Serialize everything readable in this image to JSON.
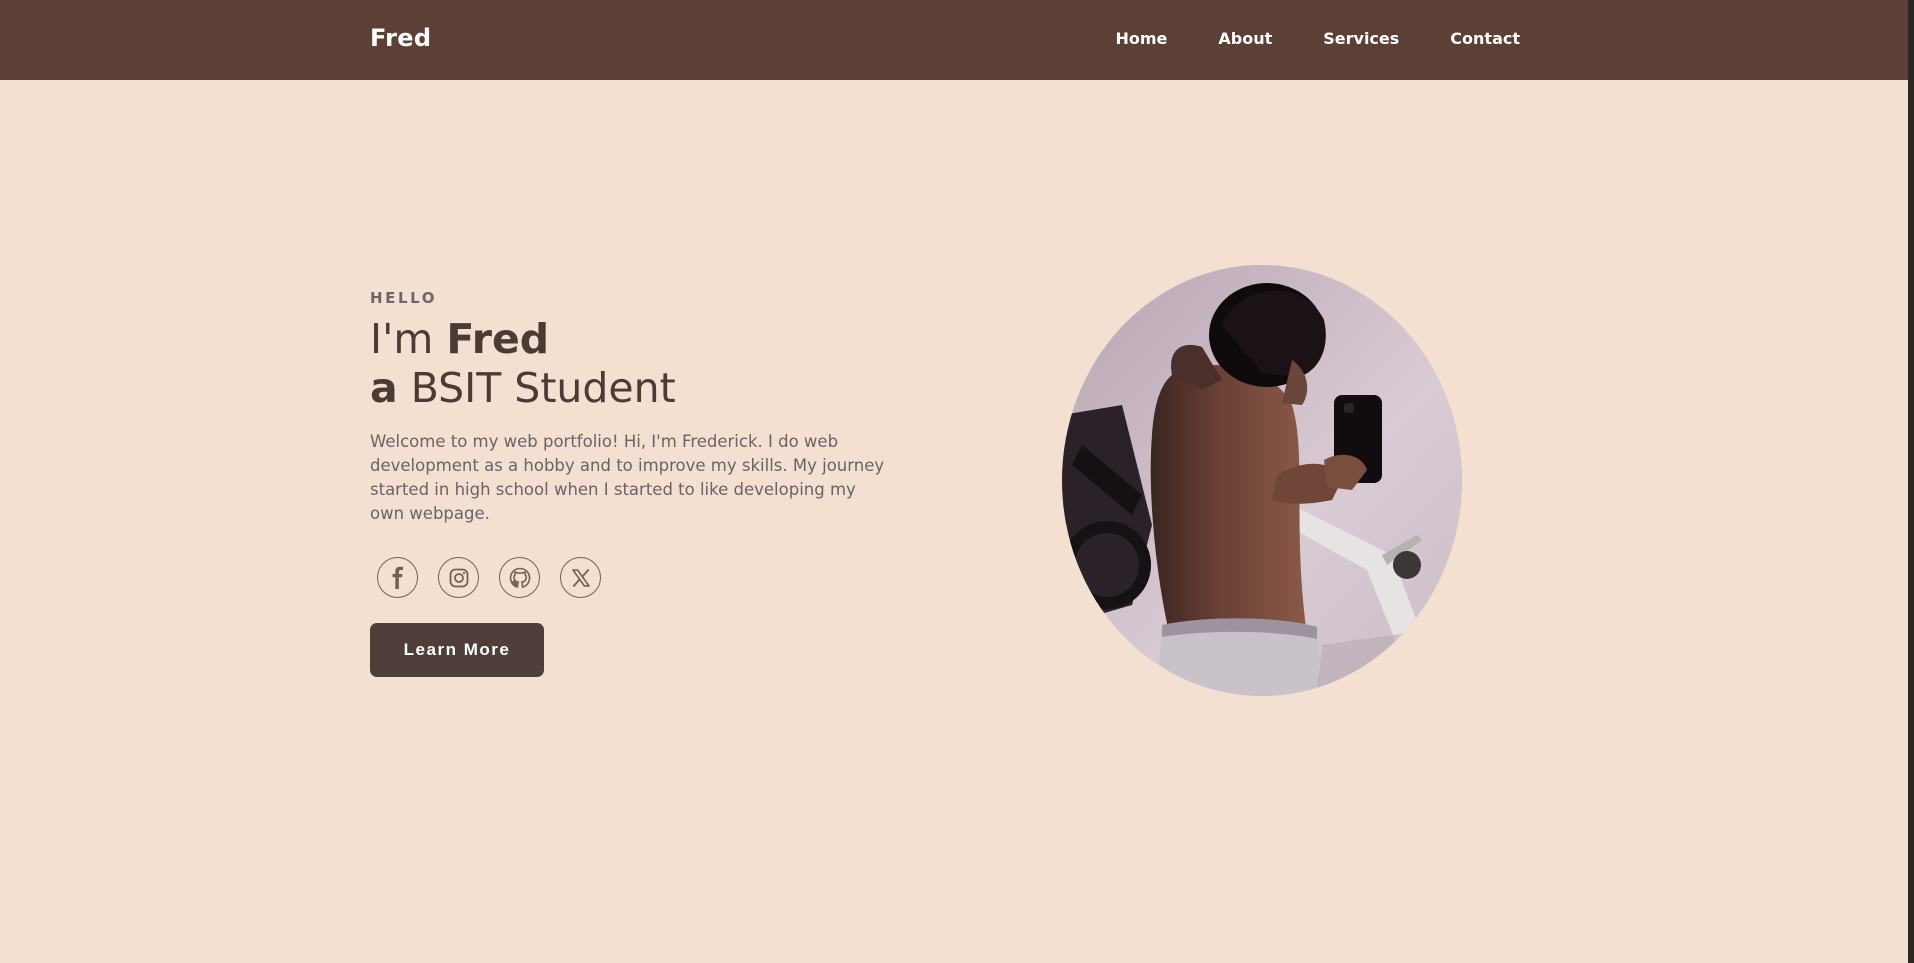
{
  "nav": {
    "brand": "Fred",
    "links": [
      {
        "label": "Home"
      },
      {
        "label": "About"
      },
      {
        "label": "Services"
      },
      {
        "label": "Contact"
      }
    ]
  },
  "hero": {
    "greeting": "HELLO",
    "line1_prefix": "I'm ",
    "line1_name": "Fred",
    "line2_prefix": "a",
    "line2_rest": " BSIT Student",
    "intro": "Welcome to my web portfolio! Hi, I'm Frederick. I do web development as a hobby and to improve my skills. My journey started in high school when I started to like developing my own webpage.",
    "socials": [
      {
        "icon": "facebook-icon"
      },
      {
        "icon": "instagram-icon"
      },
      {
        "icon": "github-icon"
      },
      {
        "icon": "x-icon"
      }
    ],
    "cta_label": "Learn More"
  },
  "colors": {
    "nav_bg": "#5c4035",
    "page_bg": "#f4e0d0",
    "heading": "#4d3a35",
    "body_text": "#6c6168",
    "button_bg": "#4f3f3b"
  }
}
